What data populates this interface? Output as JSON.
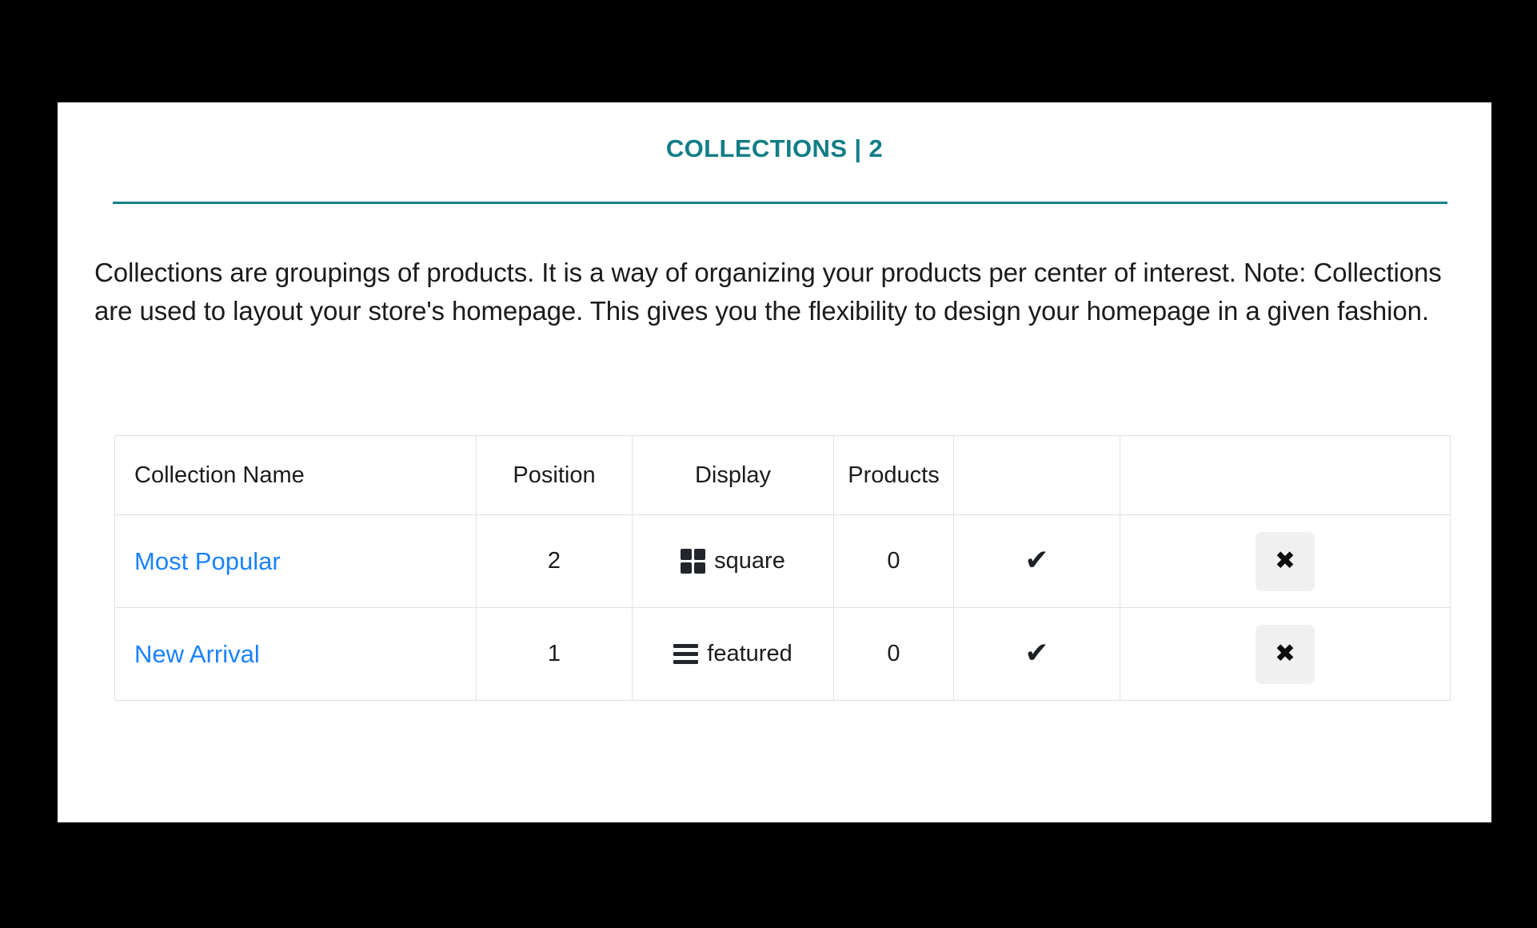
{
  "page": {
    "title": "COLLECTIONS | 2",
    "accent_color": "#127d85",
    "rule_color": "#17808c",
    "link_color": "#1a82fb",
    "background_color": "#000000",
    "card_color": "#ffffff",
    "description": "Collections are groupings of products. It is a way of organizing your products per center of interest. Note: Collections are used to layout your store's homepage. This gives you the flexibility to design your homepage in a given fashion."
  },
  "table": {
    "headers": {
      "name": "Collection Name",
      "position": "Position",
      "display": "Display",
      "products": "Products",
      "status": "",
      "actions": ""
    },
    "rows": [
      {
        "name": "Most Popular",
        "position": "2",
        "display_label": "square",
        "display_icon": "grid-square-icon",
        "products": "0",
        "status_icon": "check-icon",
        "status_glyph": "✔",
        "delete_icon": "close-icon",
        "delete_glyph": "✖"
      },
      {
        "name": "New Arrival",
        "position": "1",
        "display_label": "featured",
        "display_icon": "list-bars-icon",
        "products": "0",
        "status_icon": "check-icon",
        "status_glyph": "✔",
        "delete_icon": "close-icon",
        "delete_glyph": "✖"
      }
    ]
  }
}
